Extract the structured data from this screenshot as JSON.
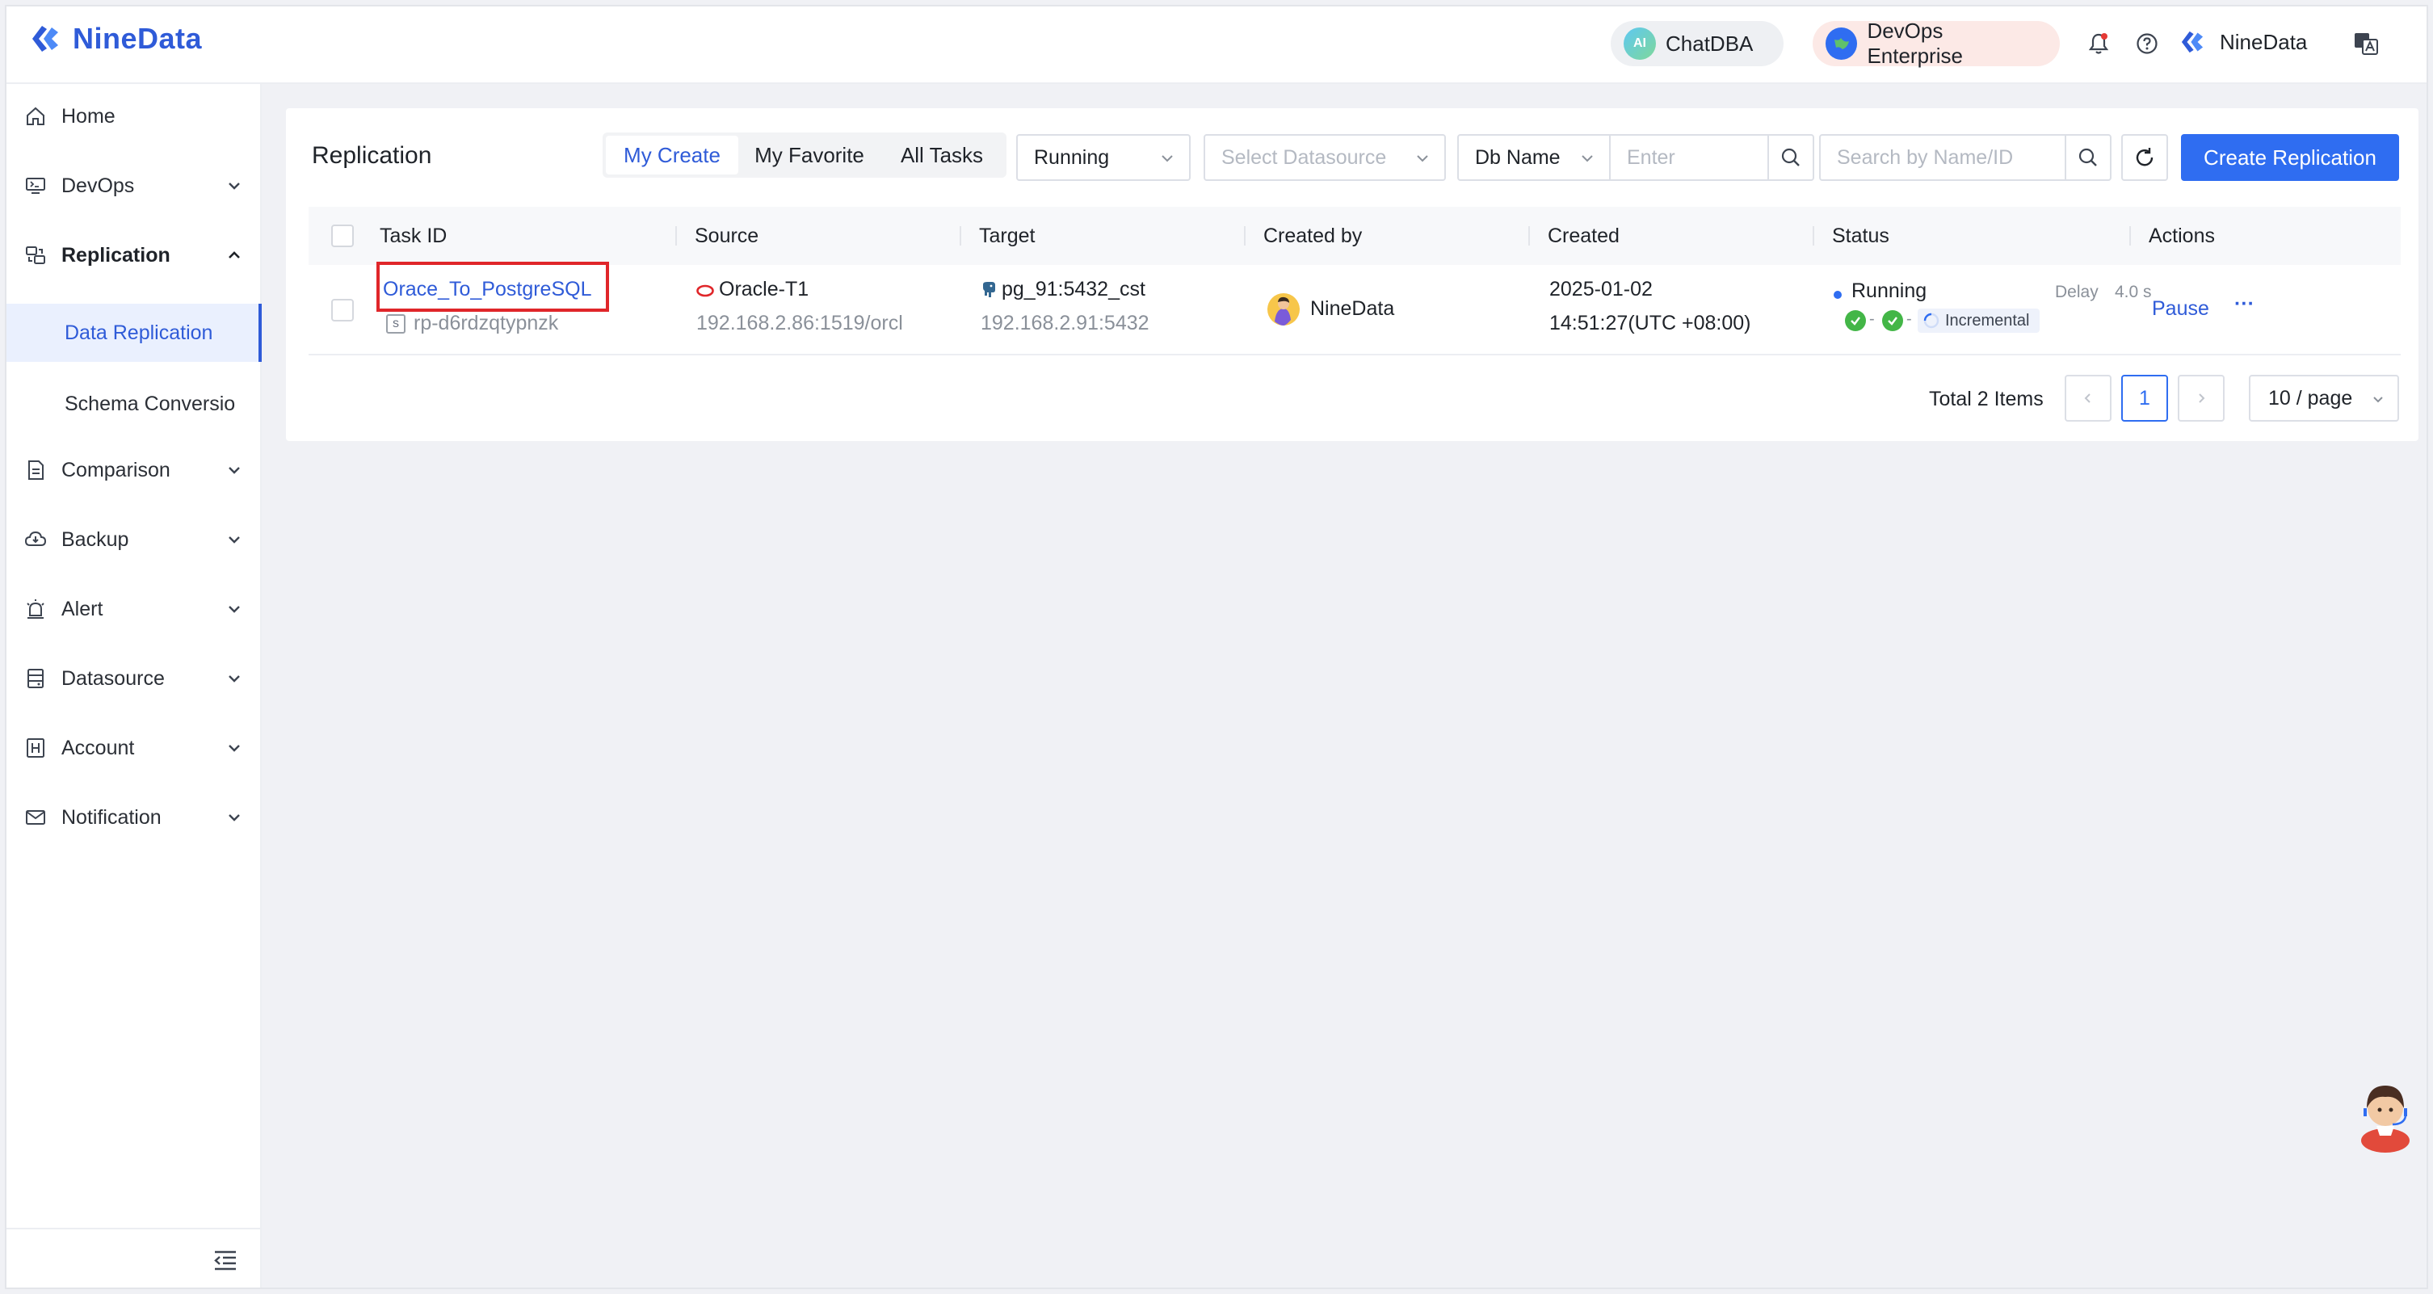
{
  "header": {
    "logo_text": "NineData",
    "chatdba_label": "ChatDBA",
    "chatdba_badge": "AI",
    "devops_label": "DevOps Enterprise",
    "user_name": "NineData"
  },
  "sidebar": {
    "items": [
      {
        "label": "Home",
        "icon": "home-icon"
      },
      {
        "label": "DevOps",
        "icon": "devops-icon"
      },
      {
        "label": "Replication",
        "icon": "replication-icon"
      },
      {
        "label": "Data Replication"
      },
      {
        "label": "Schema Conversio"
      },
      {
        "label": "Comparison",
        "icon": "comparison-icon"
      },
      {
        "label": "Backup",
        "icon": "backup-icon"
      },
      {
        "label": "Alert",
        "icon": "alert-icon"
      },
      {
        "label": "Datasource",
        "icon": "datasource-icon"
      },
      {
        "label": "Account",
        "icon": "account-icon"
      },
      {
        "label": "Notification",
        "icon": "notification-icon"
      }
    ]
  },
  "main": {
    "title": "Replication",
    "tabs": [
      "My Create",
      "My Favorite",
      "All Tasks"
    ],
    "status_filter": "Running",
    "datasource_placeholder": "Select Datasource",
    "dbname_select": "Db Name",
    "dbname_placeholder": "Enter",
    "search_placeholder": "Search by Name/ID",
    "create_button": "Create Replication"
  },
  "table": {
    "columns": [
      "Task ID",
      "Source",
      "Target",
      "Created by",
      "Created",
      "Status",
      "Actions"
    ],
    "rows": [
      {
        "task_name": "Orace_To_PostgreSQL",
        "task_tag": "s",
        "task_id": "rp-d6rdzqtypnzk",
        "source_name": "Oracle-T1",
        "source_addr": "192.168.2.86:1519/orcl",
        "target_name": "pg_91:5432_cst",
        "target_addr": "192.168.2.91:5432",
        "created_by": "NineData",
        "created_date": "2025-01-02",
        "created_time": "14:51:27(UTC +08:00)",
        "status": "Running",
        "delay_label": "Delay",
        "delay_value": "4.0 s",
        "phase": "Incremental",
        "action_pause": "Pause",
        "action_more": "···"
      }
    ]
  },
  "pagination": {
    "total": "Total 2 Items",
    "current_page": "1",
    "page_size": "10 / page"
  },
  "colors": {
    "primary": "#2f6df1",
    "highlight_box": "#e0262a",
    "success": "#43b647"
  }
}
